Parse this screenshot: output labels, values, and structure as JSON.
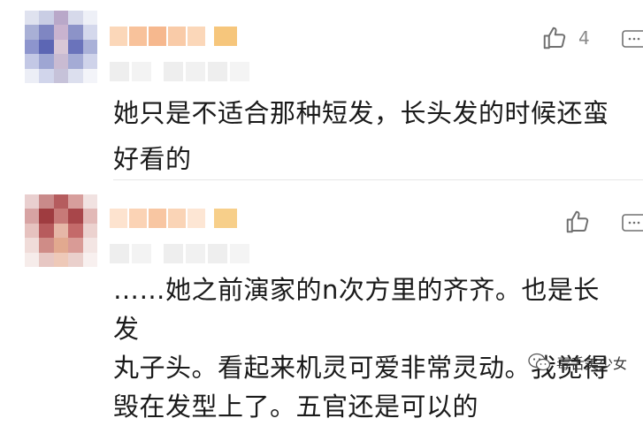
{
  "comments": [
    {
      "like_count": "4",
      "text_line1": "她只是不适合那种短发，长头发的时候还蛮",
      "text_line2": "好看的"
    },
    {
      "like_count": "",
      "text_line1": "……她之前演家的n次方里的齐齐。也是长发",
      "text_line2": "丸子头。看起来机灵可爱非常灵动。我觉得",
      "text_line3": "毁在发型上了。五官还是可以的"
    }
  ],
  "watermark": {
    "label": "毒舌美少女"
  },
  "icons": [
    "thumbs-up-icon",
    "reply-icon",
    "wechat-logo-icon"
  ],
  "colors": {
    "text": "#1a1a1a",
    "muted": "#8a8a8a",
    "divider": "#e6e6e6",
    "nick_blur": "#f6c49a"
  }
}
